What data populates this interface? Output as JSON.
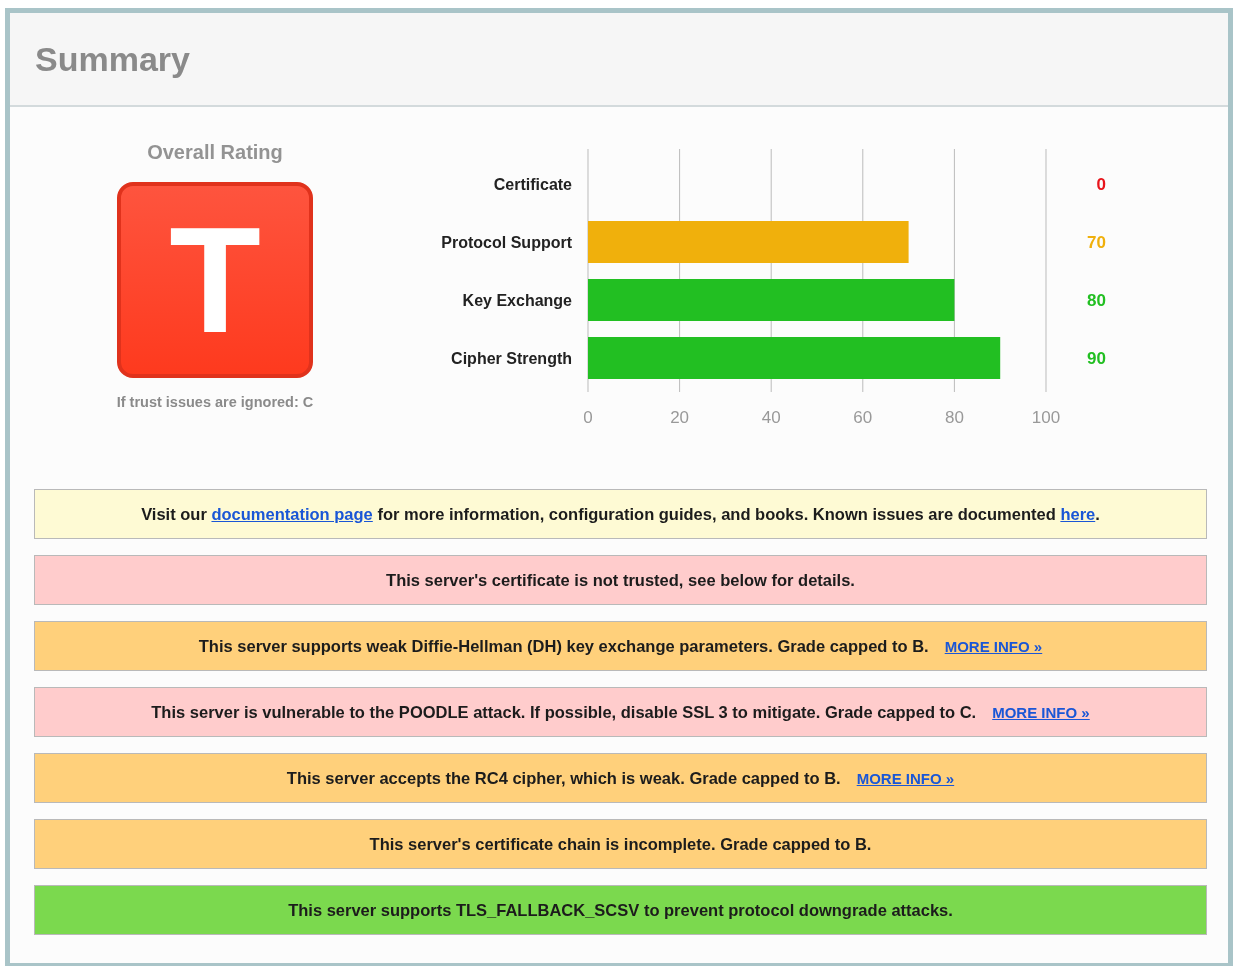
{
  "title": "Summary",
  "rating": {
    "heading": "Overall Rating",
    "grade": "T",
    "note": "If trust issues are ignored: C"
  },
  "rows": [
    {
      "score": "0",
      "color": "#e8141b"
    },
    {
      "score": "70",
      "color": "#f0b00c"
    },
    {
      "score": "80",
      "color": "#22bf22"
    },
    {
      "score": "90",
      "color": "#22bf22"
    }
  ],
  "chart_data": {
    "type": "bar",
    "orientation": "horizontal",
    "categories": [
      "Certificate",
      "Protocol Support",
      "Key Exchange",
      "Cipher Strength"
    ],
    "values": [
      0,
      70,
      80,
      90
    ],
    "xlim": [
      0,
      100
    ],
    "xticks": [
      0,
      20,
      40,
      60,
      80,
      100
    ],
    "grid": true
  },
  "notices": [
    {
      "kind": "info",
      "parts": [
        {
          "text": "Visit our "
        },
        {
          "link": "documentation page"
        },
        {
          "text": " for more information, configuration guides, and books. Known issues are documented "
        },
        {
          "link": "here"
        },
        {
          "text": "."
        }
      ]
    },
    {
      "kind": "error",
      "parts": [
        {
          "text": "This server's certificate is not trusted, see below for details."
        }
      ]
    },
    {
      "kind": "warning",
      "parts": [
        {
          "text": "This server supports weak Diffie-Hellman (DH) key exchange parameters. Grade capped to B."
        }
      ],
      "more_info": "MORE INFO »"
    },
    {
      "kind": "error",
      "parts": [
        {
          "text": "This server is vulnerable to the POODLE attack. If possible, disable SSL 3 to mitigate. Grade capped to C."
        }
      ],
      "more_info": "MORE INFO »"
    },
    {
      "kind": "warning",
      "parts": [
        {
          "text": "This server accepts the RC4 cipher, which is weak. Grade capped to B."
        }
      ],
      "more_info": "MORE INFO »"
    },
    {
      "kind": "warning",
      "parts": [
        {
          "text": "This server's certificate chain is incomplete. Grade capped to B."
        }
      ]
    },
    {
      "kind": "good",
      "parts": [
        {
          "text": "This server supports TLS_FALLBACK_SCSV to prevent protocol downgrade attacks."
        }
      ]
    }
  ]
}
